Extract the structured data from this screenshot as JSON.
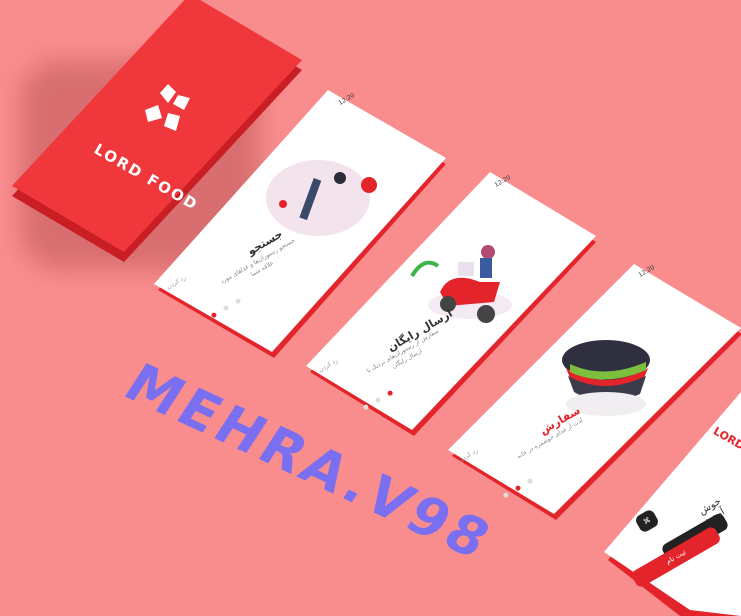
{
  "splash": {
    "brand": "LORD FOOD"
  },
  "screens": [
    {
      "status_time": "12:20",
      "title": "جستجو",
      "desc": "جستجو رستوران‌ها و غذاهای مورد علاقه شما",
      "skip": "رد کردن"
    },
    {
      "status_time": "12:20",
      "title": "ارسال رایگان",
      "desc": "سفارش از رستوران‌های نزدیک با ارسال رایگان",
      "skip": "رد کردن"
    },
    {
      "status_time": "12:20",
      "title": "سفارش",
      "desc": "لذت از غذای خوشمزه در خانه",
      "skip": "رد کردن"
    }
  ],
  "welcome": {
    "brand": "LORD",
    "title": "خوش آمدید",
    "login_label": "ورود",
    "register_label": "ثبت نام"
  },
  "watermark": "MEHRA.V98",
  "colors": {
    "background": "#f98d8e",
    "brand_red": "#e3252b",
    "watermark": "#7a6ff0"
  }
}
